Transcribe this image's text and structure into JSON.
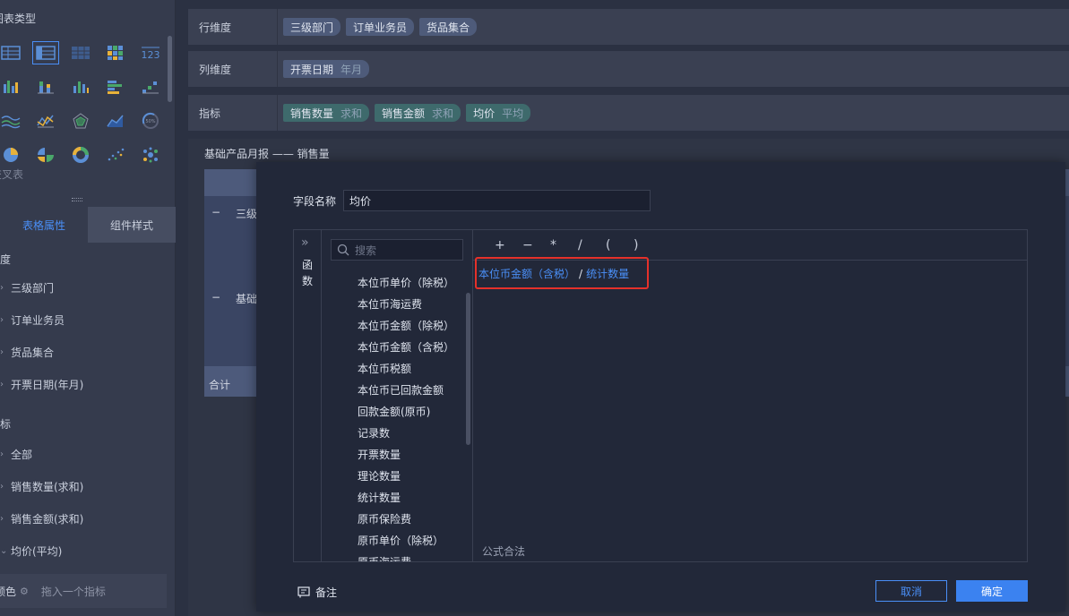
{
  "left_panel": {
    "chart_type_title": "图表类型",
    "chart_icons": [
      [
        "table-icon",
        "cross-table-icon",
        "detail-table-icon",
        "heatmap-table-icon",
        "kpi-number-icon"
      ],
      [
        "grouped-column-icon",
        "stacked-column-icon",
        "column-icon",
        "bar-icon",
        "step-icon"
      ],
      [
        "line-wave-icon",
        "line-icon",
        "radar-icon",
        "area-icon",
        "gauge-icon"
      ],
      [
        "pie-icon",
        "pie-split-icon",
        "donut-icon",
        "scatter-icon",
        "bubble-icon"
      ]
    ],
    "cross_table_label": "交叉表",
    "tabs": {
      "table_props": "表格属性",
      "component_style": "组件样式"
    },
    "dimension_group": "维度",
    "dimensions": [
      "三级部门",
      "订单业务员",
      "货品集合",
      "开票日期(年月)"
    ],
    "metric_group": "指标",
    "metrics": [
      "全部",
      "销售数量(求和)",
      "销售金额(求和)",
      "均价(平均)"
    ],
    "color_label": "颜色",
    "drop_hint": "拖入一个指标"
  },
  "rows": {
    "row_dim_label": "行维度",
    "row_dims": [
      "三级部门",
      "订单业务员",
      "货品集合"
    ],
    "col_dim_label": "列维度",
    "col_dim": {
      "name": "开票日期",
      "sub": "年月"
    },
    "metric_label": "指标",
    "metrics": [
      {
        "name": "销售数量",
        "sub": "求和"
      },
      {
        "name": "销售金额",
        "sub": "求和"
      },
      {
        "name": "均价",
        "sub": "平均"
      }
    ]
  },
  "chart": {
    "title": "基础产品月报 —— 销售量",
    "row1_label": "三级",
    "row2_label": "基础",
    "total_label": "合计",
    "collapse_glyph": "−"
  },
  "modal": {
    "field_name_label": "字段名称",
    "field_name_value": "均价",
    "fn_tab": "函数",
    "search_placeholder": "搜索",
    "fields": [
      "本位币单价（除税）",
      "本位币海运费",
      "本位币金额（除税）",
      "本位币金额（含税）",
      "本位币税额",
      "本位币已回款金额",
      "回款金额(原币)",
      "记录数",
      "开票数量",
      "理论数量",
      "统计数量",
      "原币保险费",
      "原币单价（除税）",
      "原币海运费"
    ],
    "operators": [
      "+",
      "−",
      "*",
      "/",
      "(",
      ")"
    ],
    "formula": {
      "token1": "本位币金额（含税）",
      "operator": "/",
      "token2": "统计数量"
    },
    "validation": "公式合法",
    "note_label": "备注",
    "cancel": "取消",
    "ok": "确定"
  },
  "colors": {
    "accent": "#4a8ff7",
    "highlight_border": "#e5312a",
    "modal_bg": "#222839",
    "page_bg": "#2b3142"
  }
}
